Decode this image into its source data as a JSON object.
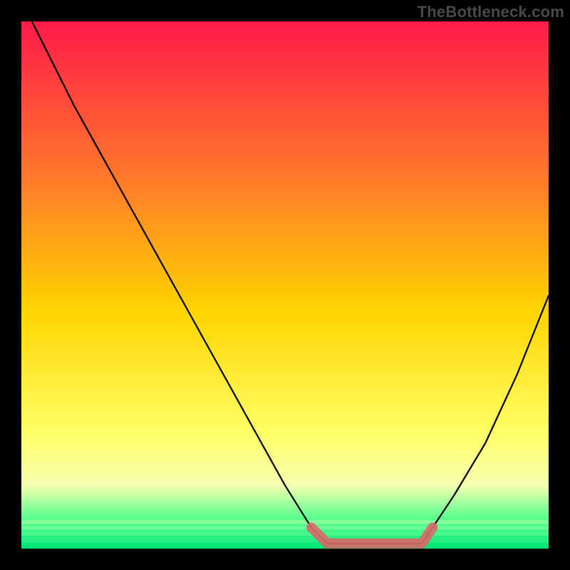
{
  "watermark": "TheBottleneck.com",
  "colors": {
    "gradient_top": "#ff1a4a",
    "gradient_mid1": "#ff7a2a",
    "gradient_mid2": "#ffd400",
    "gradient_mid3": "#ffff66",
    "gradient_mid4": "#f6ffb0",
    "gradient_bot1": "#5fff8f",
    "gradient_green": "#00e676",
    "curve": "#000000",
    "highlight": "#d76a6a",
    "frame": "#000000"
  },
  "chart_data": {
    "type": "line",
    "title": "",
    "xlabel": "",
    "ylabel": "",
    "xlim": [
      0,
      100
    ],
    "ylim": [
      0,
      100
    ],
    "series": [
      {
        "name": "curve",
        "x": [
          2,
          10,
          20,
          30,
          40,
          50,
          55,
          58,
          63,
          70,
          76,
          78,
          82,
          88,
          94,
          100
        ],
        "values": [
          100,
          84,
          66,
          48,
          30,
          12,
          4,
          1,
          1,
          1,
          1,
          4,
          10,
          20,
          33,
          48
        ]
      },
      {
        "name": "highlight-flat",
        "x": [
          55,
          58,
          63,
          70,
          76,
          78
        ],
        "values": [
          4,
          1,
          1,
          1,
          1,
          4
        ]
      }
    ],
    "annotations": []
  }
}
